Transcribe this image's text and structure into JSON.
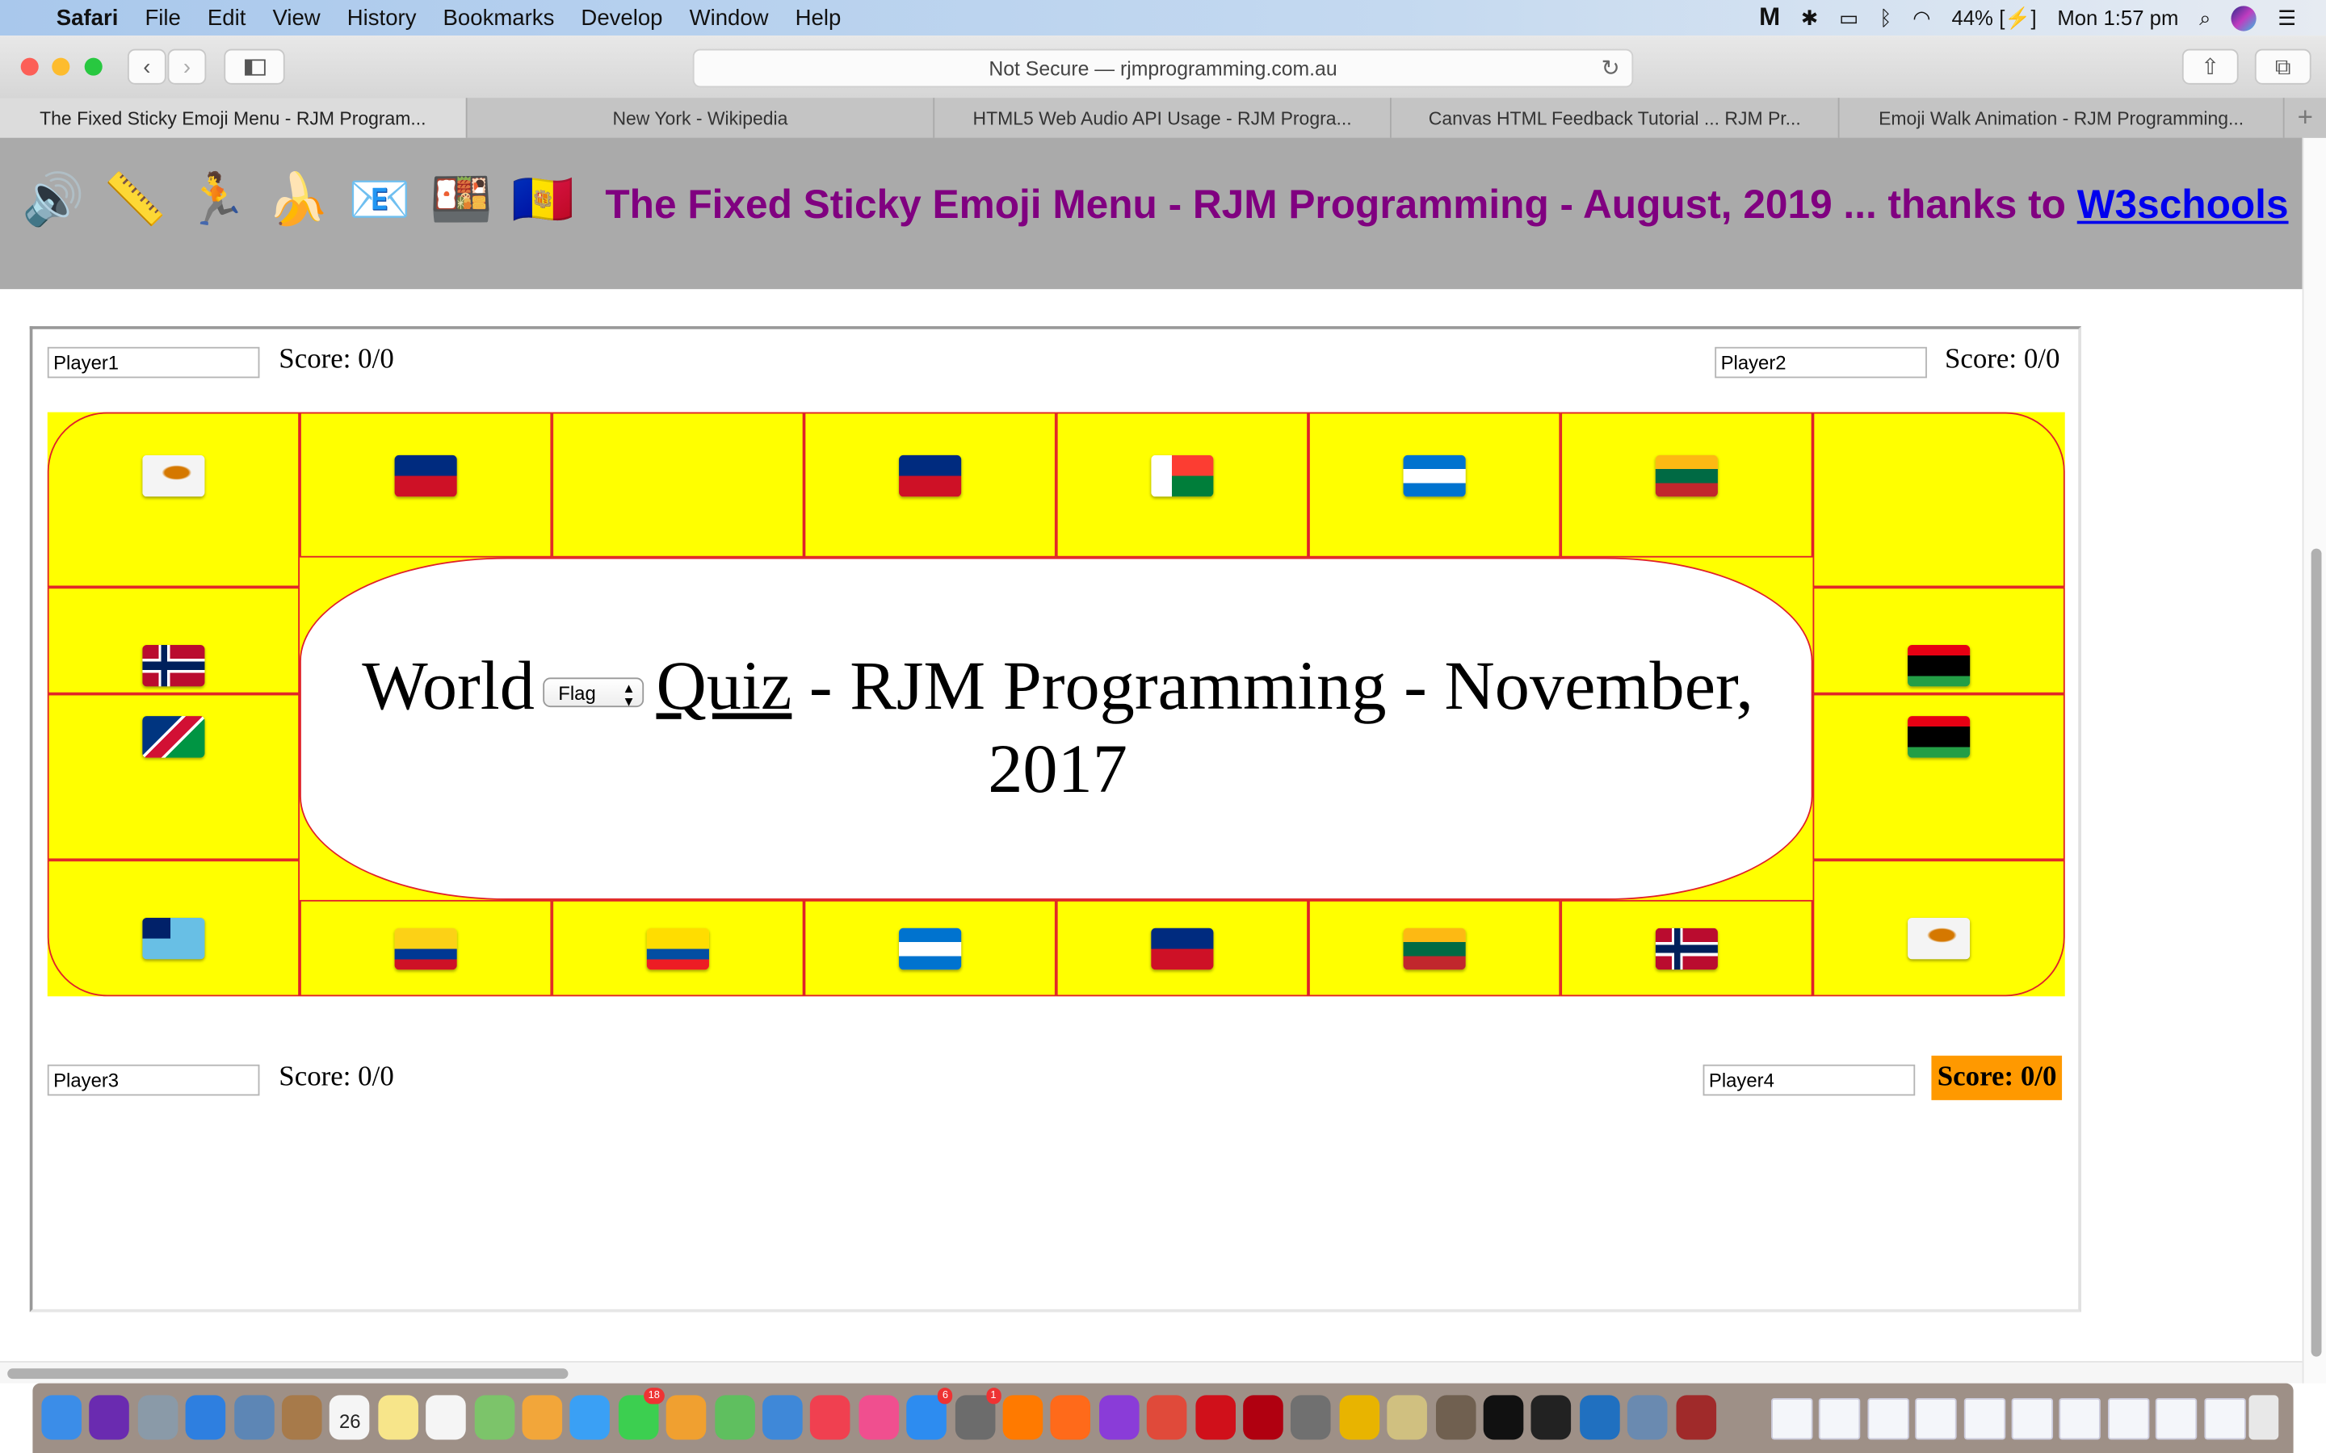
{
  "menubar": {
    "app": "Safari",
    "items": [
      "File",
      "Edit",
      "View",
      "History",
      "Bookmarks",
      "Develop",
      "Window",
      "Help"
    ],
    "battery": "44%",
    "clock": "Mon 1:57 pm",
    "status_icons": [
      "malwarebytes-icon",
      "avast-icon",
      "airplay-icon",
      "bluetooth-icon",
      "wifi-icon",
      "battery-icon",
      "spotlight-icon",
      "siri-icon",
      "notification-center-icon"
    ]
  },
  "toolbar": {
    "address": "Not Secure — rjmprogramming.com.au"
  },
  "tabs": [
    {
      "label": "The Fixed Sticky Emoji Menu - RJM Program...",
      "active": true
    },
    {
      "label": "New York - Wikipedia",
      "active": false
    },
    {
      "label": "HTML5 Web Audio API Usage - RJM Progra...",
      "active": false
    },
    {
      "label": "Canvas HTML Feedback Tutorial ... RJM Pr...",
      "active": false
    },
    {
      "label": "Emoji Walk Animation - RJM Programming...",
      "active": false
    }
  ],
  "header": {
    "emoji_menu": [
      {
        "name": "speaker",
        "glyph": "🔊"
      },
      {
        "name": "ruler",
        "glyph": "📏"
      },
      {
        "name": "runner",
        "glyph": "🏃"
      },
      {
        "name": "banana",
        "glyph": "🍌"
      },
      {
        "name": "email",
        "glyph": "📧"
      },
      {
        "name": "bento",
        "glyph": "🍱"
      },
      {
        "name": "andorra-flag",
        "glyph": "🇦🇩"
      }
    ],
    "title": "The Fixed Sticky Emoji Menu - RJM Programming - August, 2019 ... thanks to ",
    "link": "W3schools",
    "title_color": "#800080",
    "link_color": "#0000ee"
  },
  "players": [
    {
      "name": "Player1",
      "score": "Score: 0/0",
      "active": false
    },
    {
      "name": "Player2",
      "score": "Score: 0/0",
      "active": false
    },
    {
      "name": "Player3",
      "score": "Score: 0/0",
      "active": false
    },
    {
      "name": "Player4",
      "score": "Score: 0/0",
      "active": true
    }
  ],
  "active_score_color": "#ff9900",
  "board": {
    "background": "#ffff00",
    "border_color": "#e0202a",
    "top_row": [
      "CY",
      "LI",
      "",
      "LI",
      "MG",
      "HN",
      "LT",
      ""
    ],
    "left_column": [
      "NO",
      "NA"
    ],
    "right_column": [
      "LY",
      "LY"
    ],
    "bottom_row": [
      "FJ",
      "CO",
      "EC",
      "HN",
      "LI",
      "LT",
      "NO",
      "CY"
    ]
  },
  "quiz": {
    "title_before": "World",
    "select_value": "Flag",
    "link": "Quiz",
    "title_after": " - RJM Programming - November, 2017"
  },
  "dock": {
    "apps": [
      "Finder",
      "Siri",
      "Launchpad",
      "Safari",
      "Preview",
      "Contacts",
      "Calendar",
      "Notes",
      "Reminders",
      "Maps",
      "Photos",
      "Messages",
      "FaceTime",
      "Pages",
      "Numbers",
      "Keynote",
      "News",
      "iTunes",
      "App Store",
      "System Preferences",
      "Avast",
      "Firefox",
      "PhpStorm",
      "Chrome",
      "Opera",
      "FileZilla",
      "Sequel Pro",
      "Cyberduck",
      "Script Editor",
      "GIMP",
      "Terminal",
      "Inkscape",
      "QuickTime",
      "Image Capture",
      "Dictionary"
    ],
    "calendar_day": "26",
    "badges": {
      "FaceTime": "18",
      "App Store": "6",
      "System Preferences": "1"
    }
  }
}
